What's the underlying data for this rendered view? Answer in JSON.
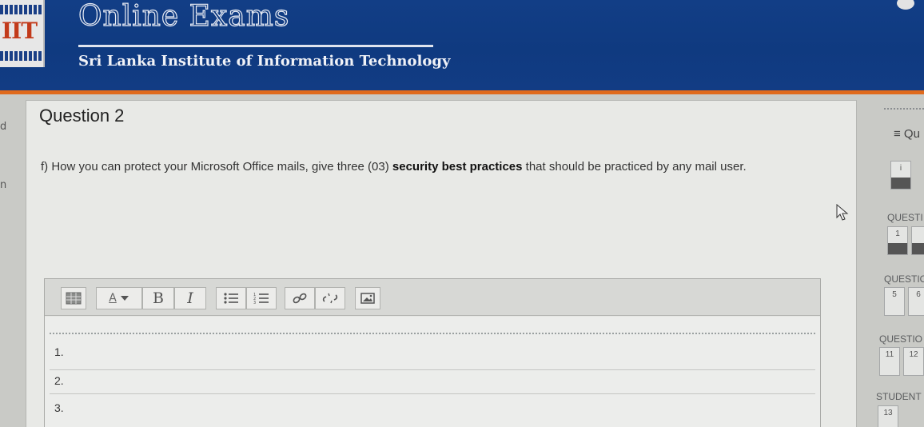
{
  "header": {
    "logo_text": "IIT",
    "app_title": "Online Exams",
    "subtitle": "Sri Lanka Institute of Information Technology"
  },
  "left_strip": {
    "fragment_a": "d",
    "fragment_b": "n"
  },
  "question": {
    "title": "Question 2",
    "label": "f)",
    "text_before": "How you can protect your Microsoft Office mails, give three (03)",
    "text_bold": "security best practices",
    "text_after": "that should be practiced by any mail user."
  },
  "editor": {
    "toolbar": {
      "format_button_label": "A",
      "bold_label": "B",
      "italic_label": "I"
    },
    "answer_lines": [
      "1.",
      "2.",
      "3."
    ]
  },
  "right_panel": {
    "nav_label": "≡ Qu",
    "current_box": "i",
    "sections": [
      {
        "label": "QUESTI",
        "boxes": [
          "1",
          ""
        ]
      },
      {
        "label": "QUESTIO",
        "boxes": [
          "5",
          "6"
        ]
      },
      {
        "label": "QUESTIO",
        "boxes": [
          "11",
          "12"
        ]
      },
      {
        "label": "STUDENT",
        "boxes": [
          "13"
        ]
      }
    ]
  },
  "colors": {
    "header_blue": "#123e86",
    "accent_orange": "#e06a1c",
    "answered_fill": "#555555"
  }
}
